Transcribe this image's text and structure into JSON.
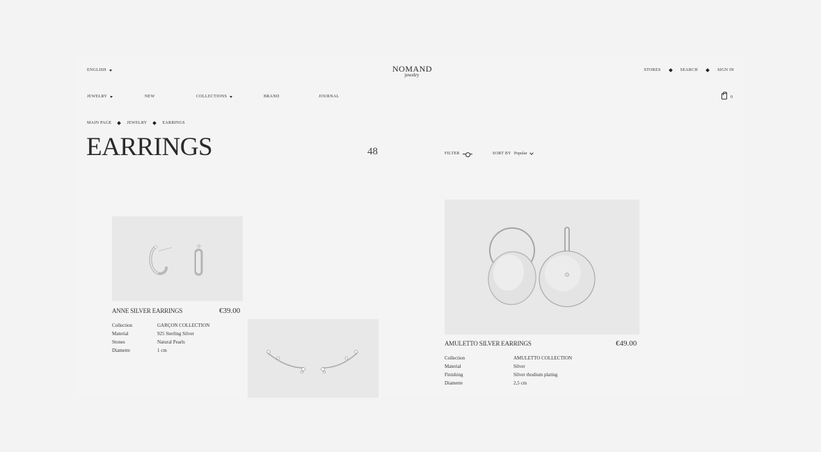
{
  "header": {
    "language": "ENGLISH",
    "logo_brand": "NOMAND",
    "logo_sub": "jewelry",
    "stores": "STORES",
    "search": "SEARCH",
    "sign_in": "SIGN IN"
  },
  "nav": {
    "jewelry": "JEWELRY",
    "new": "NEW",
    "collections": "COLLECTIONS",
    "brand": "BRAND",
    "journal": "JOURNAL",
    "cart_count": "0"
  },
  "breadcrumb": [
    "MAIN PAGE",
    "JEWELRY",
    "EARRINGS"
  ],
  "page": {
    "title": "EARRINGS",
    "count": "48",
    "filter_label": "FILTER",
    "sort_label": "SORT BY",
    "sort_value": "Popular"
  },
  "products": [
    {
      "name": "ANNE SILVER EARRINGS",
      "price": "€39.00",
      "specs": [
        {
          "label": "Collection",
          "value": "GARÇON COLLECTION"
        },
        {
          "label": "Material",
          "value": "925 Sterling Silver"
        },
        {
          "label": "Stones",
          "value": "Natural Pearls"
        },
        {
          "label": "Diametre",
          "value": "1 cm"
        }
      ]
    },
    {
      "name": "AMULETTO SILVER EARRINGS",
      "price": "€49.00",
      "specs": [
        {
          "label": "Collection",
          "value": "AMULETTO COLLECTION"
        },
        {
          "label": "Material",
          "value": "Silver"
        },
        {
          "label": "Finishing",
          "value": "Silver rhodium plating"
        },
        {
          "label": "Diametre",
          "value": "2,5 cm"
        }
      ]
    }
  ]
}
